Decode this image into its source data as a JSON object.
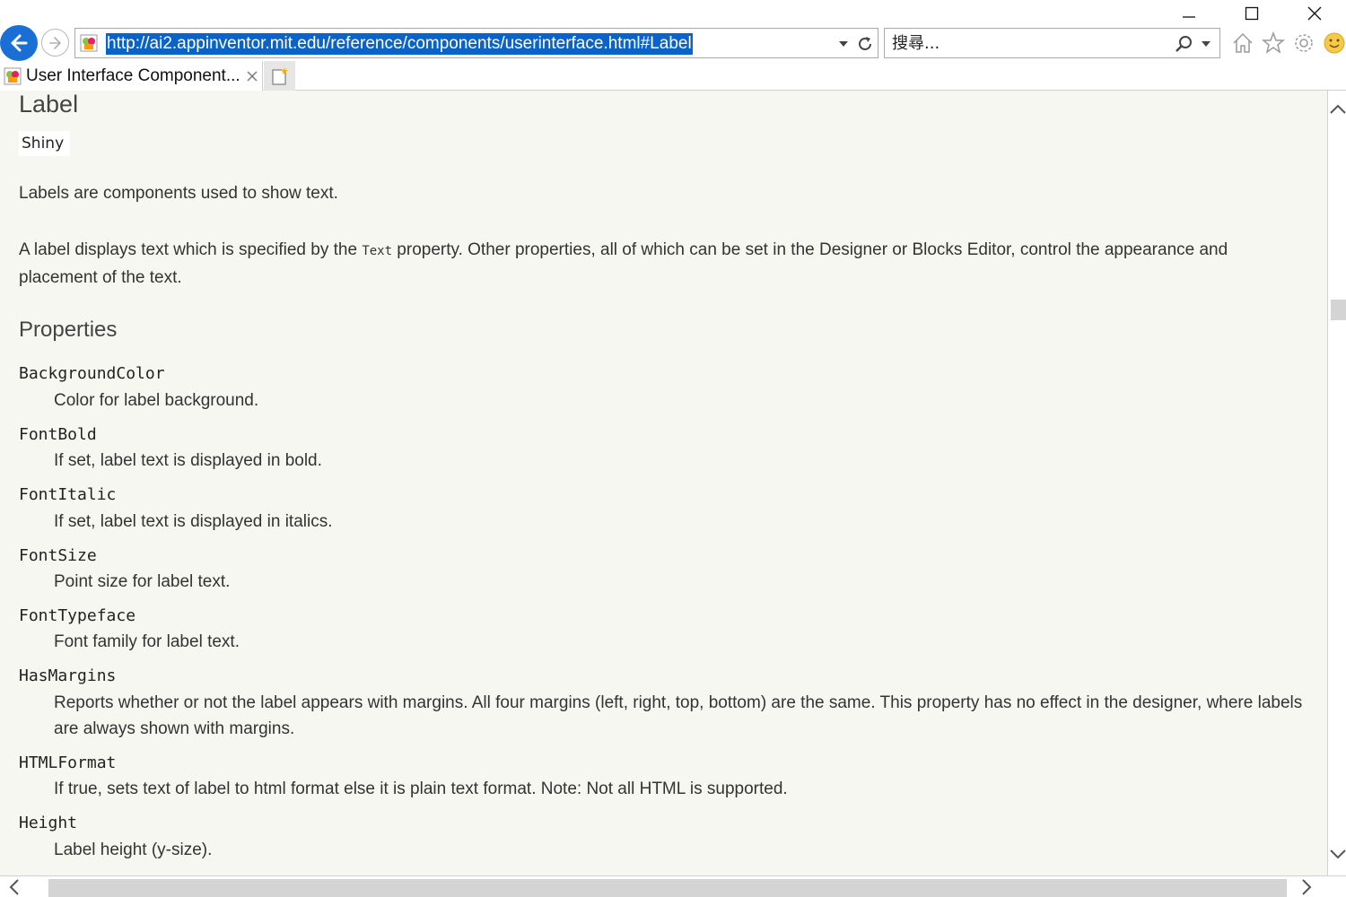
{
  "browser": {
    "address_url": "http://ai2.appinventor.mit.edu/reference/components/userinterface.html#Label",
    "search_placeholder": "搜尋...",
    "tab_title": "User Interface Component...",
    "accent_color": "#1a6fd6"
  },
  "page": {
    "heading": "Label",
    "demo_label": "Shiny",
    "intro": "Labels are components used to show text.",
    "desc_before": "A label displays text which is specified by the ",
    "desc_code": "Text",
    "desc_after": " property. Other properties, all of which can be set in the Designer or Blocks Editor, control the appearance and placement of the text.",
    "properties_heading": "Properties",
    "properties": [
      {
        "name": "BackgroundColor",
        "desc": "Color for label background."
      },
      {
        "name": "FontBold",
        "desc": "If set, label text is displayed in bold."
      },
      {
        "name": "FontItalic",
        "desc": "If set, label text is displayed in italics."
      },
      {
        "name": "FontSize",
        "desc": "Point size for label text."
      },
      {
        "name": "FontTypeface",
        "desc": "Font family for label text."
      },
      {
        "name": "HasMargins",
        "desc": "Reports whether or not the label appears with margins. All four margins (left, right, top, bottom) are the same. This property has no effect in the designer, where labels are always shown with margins."
      },
      {
        "name": "HTMLFormat",
        "desc": "If true, sets text of label to html format else it is plain text format. Note: Not all HTML is supported."
      },
      {
        "name": "Height",
        "desc": "Label height (y-size)."
      }
    ]
  }
}
